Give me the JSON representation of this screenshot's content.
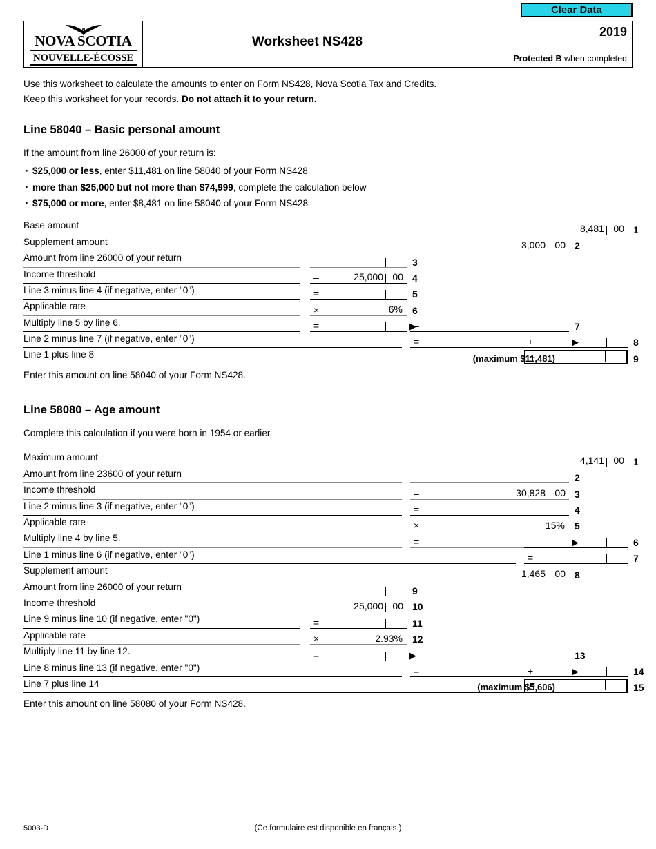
{
  "toolbar": {
    "clear_data_label": "Clear Data"
  },
  "header": {
    "logo_line1": "NOVA SCOTIA",
    "logo_line2": "NOUVELLE-ÉCOSSE",
    "title": "Worksheet NS428",
    "year": "2019",
    "protected_bold": "Protected B",
    "protected_rest": " when completed"
  },
  "intro": {
    "line1": "Use this worksheet to calculate the amounts to enter on Form NS428, Nova Scotia Tax and Credits.",
    "line2_plain": "Keep this worksheet for your records. ",
    "line2_bold": "Do not attach it to your return."
  },
  "section1": {
    "heading": "Line 58040 – Basic personal amount",
    "intro": "If the amount from line 26000 of your return is:",
    "bullets": [
      {
        "bold": "$25,000 or less",
        "rest": ", enter $11,481 on line 58040 of your Form NS428"
      },
      {
        "bold": "more than $25,000 but not more than $74,999",
        "rest": ", complete the calculation below"
      },
      {
        "bold": "$75,000 or more",
        "rest": ", enter $8,481 on line 58040 of your Form NS428"
      }
    ],
    "rows": [
      {
        "label": "Base amount",
        "line_no": "1",
        "value": "8,481",
        "cents": "00"
      },
      {
        "label": "Supplement amount",
        "line_no": "2",
        "value": "3,000",
        "cents": "00"
      },
      {
        "label": "Amount from line 26000 of your return",
        "line_no": "3",
        "value": "",
        "cents": "",
        "sign": ""
      },
      {
        "label": "Income threshold",
        "line_no": "4",
        "value": "25,000",
        "cents": "00",
        "sign": "–"
      },
      {
        "label": "Line 3 minus line 4 (if negative, enter \"0\")",
        "line_no": "5",
        "value": "",
        "cents": "",
        "sign": "="
      },
      {
        "label": "Applicable rate",
        "line_no": "6",
        "value": "6%",
        "cents": "",
        "sign": "×"
      },
      {
        "label": "Multiply line 5 by line 6.",
        "line_no": "7",
        "value": "",
        "cents": "",
        "sign": "=",
        "carry_sign": "–"
      },
      {
        "label": "Line 2 minus line 7 (if negative, enter \"0\")",
        "line_no": "8",
        "value": "",
        "cents": "",
        "sign": "=",
        "carry_sign": "+"
      },
      {
        "label": "Line 1 plus line 8",
        "line_no": "9",
        "value": "",
        "cents": "",
        "sign": "="
      }
    ],
    "maximum_note": "(maximum $11,481)",
    "after_note": "Enter this amount on line 58040 of your Form NS428."
  },
  "section2": {
    "heading": "Line 58080 – Age amount",
    "intro": "Complete this calculation if you were born in 1954 or earlier.",
    "rows": [
      {
        "label": "Maximum amount",
        "line_no": "1",
        "value": "4,141",
        "cents": "00"
      },
      {
        "label": "Amount from line 23600 of your return",
        "line_no": "2",
        "value": "",
        "cents": "",
        "sign": ""
      },
      {
        "label": "Income threshold",
        "line_no": "3",
        "value": "30,828",
        "cents": "00",
        "sign": "–"
      },
      {
        "label": "Line 2 minus line 3 (if negative, enter \"0\")",
        "line_no": "4",
        "value": "",
        "cents": "",
        "sign": "="
      },
      {
        "label": "Applicable rate",
        "line_no": "5",
        "value": "15%",
        "cents": "",
        "sign": "×"
      },
      {
        "label": "Multiply line 4 by line 5.",
        "line_no": "6",
        "value": "",
        "cents": "",
        "sign": "=",
        "carry_sign": "–"
      },
      {
        "label": "Line 1 minus line 6 (if negative, enter \"0\")",
        "line_no": "7",
        "value": "",
        "cents": "",
        "sign": "="
      },
      {
        "label": "Supplement amount",
        "line_no": "8",
        "value": "1,465",
        "cents": "00"
      },
      {
        "label": "Amount from line 26000 of your return",
        "line_no": "9",
        "value": "",
        "cents": "",
        "sign": ""
      },
      {
        "label": "Income threshold",
        "line_no": "10",
        "value": "25,000",
        "cents": "00",
        "sign": "–"
      },
      {
        "label": "Line 9 minus line 10 (if negative, enter \"0\")",
        "line_no": "11",
        "value": "",
        "cents": "",
        "sign": "="
      },
      {
        "label": "Applicable rate",
        "line_no": "12",
        "value": "2.93%",
        "cents": "",
        "sign": "×"
      },
      {
        "label": "Multiply line 11 by line 12.",
        "line_no": "13",
        "value": "",
        "cents": "",
        "sign": "=",
        "carry_sign": "–"
      },
      {
        "label": "Line 8 minus line 13 (if negative, enter \"0\")",
        "line_no": "14",
        "value": "",
        "cents": "",
        "sign": "=",
        "carry_sign": "+"
      },
      {
        "label": "Line 7 plus line 14",
        "line_no": "15",
        "value": "",
        "cents": "",
        "sign": "="
      }
    ],
    "maximum_note": "(maximum $5,606)",
    "after_note": "Enter this amount on line 58080 of your Form NS428."
  },
  "footer": {
    "form_code": "5003-D",
    "french_note": "(Ce formulaire est disponible en français.)"
  },
  "colors": {
    "clear_data_bg": "#2ad4e8",
    "rule": "#8a8a8a",
    "text": "#000000"
  }
}
